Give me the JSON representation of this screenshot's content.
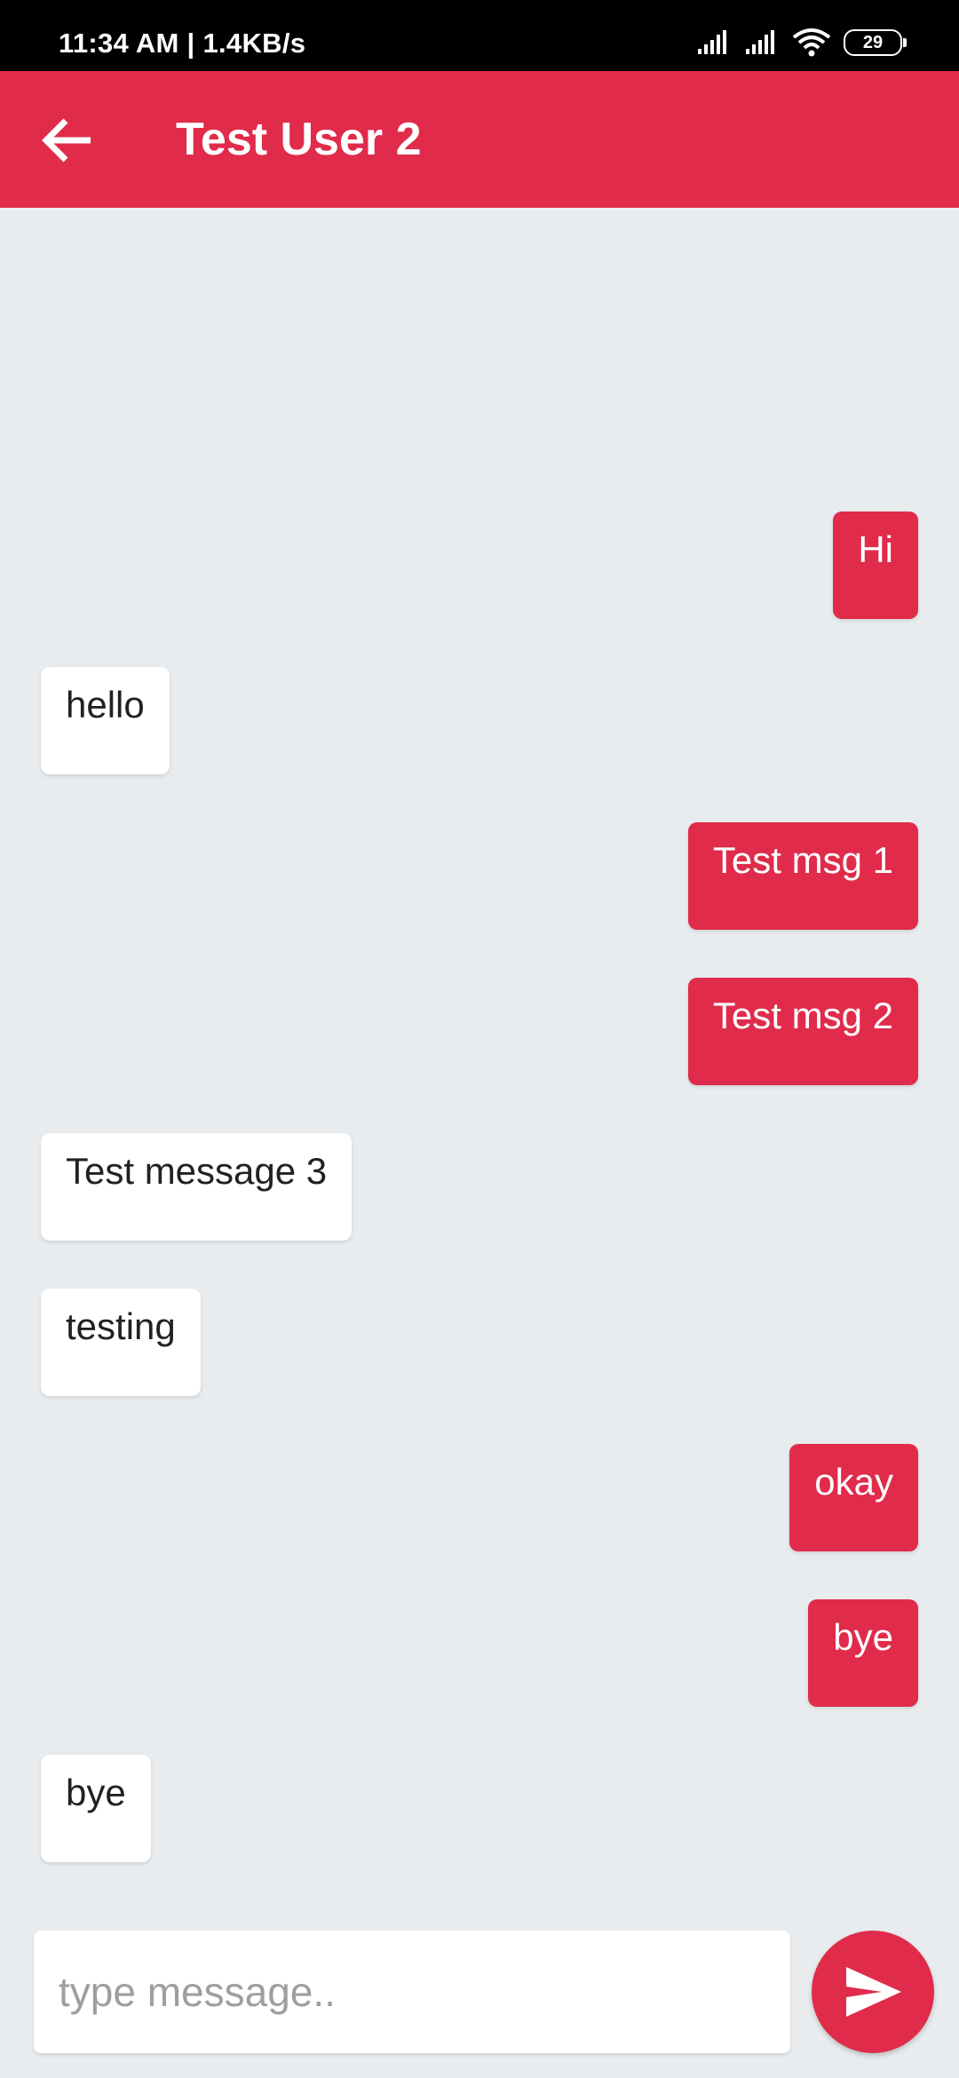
{
  "status_bar": {
    "time_speed": "11:34 AM | 1.4KB/s",
    "battery_level": "29",
    "icons": [
      "cell-signal-icon",
      "cell-signal-icon",
      "wifi-icon",
      "battery-icon"
    ]
  },
  "header": {
    "back_icon": "arrow-left-icon",
    "title": "Test User 2"
  },
  "messages": [
    {
      "direction": "out",
      "text": "Hi"
    },
    {
      "direction": "in",
      "text": "hello"
    },
    {
      "direction": "out",
      "text": "Test msg 1"
    },
    {
      "direction": "out",
      "text": "Test msg 2"
    },
    {
      "direction": "in",
      "text": "Test message 3"
    },
    {
      "direction": "in",
      "text": "testing"
    },
    {
      "direction": "out",
      "text": "okay"
    },
    {
      "direction": "out",
      "text": "bye"
    },
    {
      "direction": "in",
      "text": "bye"
    }
  ],
  "composer": {
    "placeholder": "type message..",
    "value": "",
    "send_icon": "send-icon"
  },
  "colors": {
    "accent": "#e02b4b",
    "background": "#e9ecee",
    "incoming_bubble": "#ffffff"
  }
}
